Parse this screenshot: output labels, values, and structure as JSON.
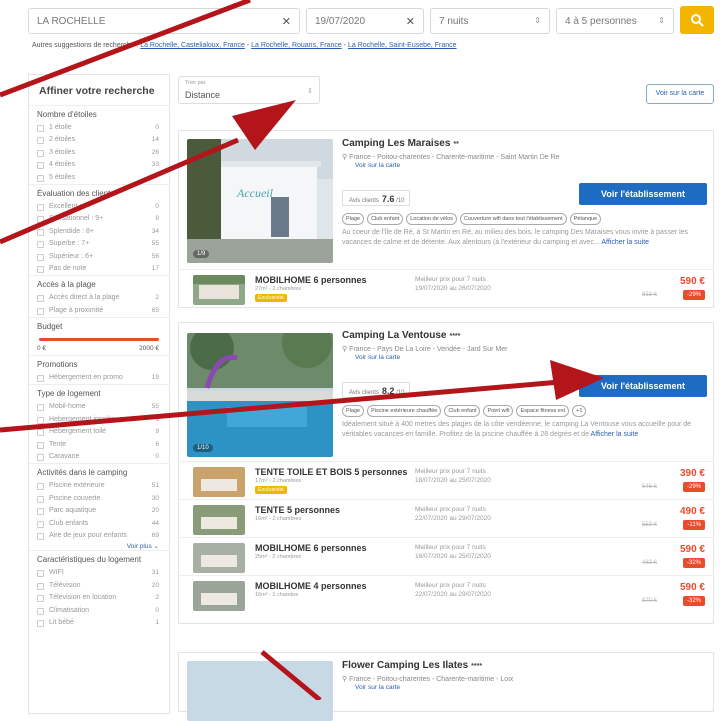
{
  "search": {
    "destination": "LA ROCHELLE",
    "date": "19/07/2020",
    "nights": "7 nuits",
    "persons": "4 à 5 personnes",
    "alt_prefix": "Autres suggestions de recherche :",
    "alt_links": [
      "La Rochelle, Castelialoux, France",
      "La Rochelle, Rouans, France",
      "La Rochelle, Saint-Eusebe, France"
    ]
  },
  "sidebar": {
    "title": "Affiner votre recherche",
    "sections": {
      "stars": {
        "title": "Nombre d'étoiles",
        "items": [
          {
            "label": "1 étoile",
            "count": "0"
          },
          {
            "label": "2 étoiles",
            "count": "14"
          },
          {
            "label": "3 étoiles",
            "count": "26"
          },
          {
            "label": "4 étoiles",
            "count": "33"
          },
          {
            "label": "5 étoiles",
            "count": ""
          }
        ]
      },
      "rating": {
        "title": "Évaluation des clients",
        "items": [
          {
            "label": "Excellent : 9+",
            "count": "0"
          },
          {
            "label": "Sensationnel : 9+",
            "count": "9"
          },
          {
            "label": "Splendide : 8+",
            "count": "34"
          },
          {
            "label": "Superbe : 7+",
            "count": "55"
          },
          {
            "label": "Supérieur : 6+",
            "count": "56"
          },
          {
            "label": "Pas de note",
            "count": "17"
          }
        ]
      },
      "beach": {
        "title": "Accès à la plage",
        "items": [
          {
            "label": "Accès direct à la plage",
            "count": "2"
          },
          {
            "label": "Plage à proximité",
            "count": "65"
          }
        ]
      },
      "budget": {
        "title": "Budget",
        "min": "0 €",
        "max": "2000 €"
      },
      "promo": {
        "title": "Promotions",
        "items": [
          {
            "label": "Hébergement en promo",
            "count": "19"
          }
        ]
      },
      "housing": {
        "title": "Type de logement",
        "items": [
          {
            "label": "Mobil-home",
            "count": "55"
          },
          {
            "label": "Hebergement insolite",
            "count": "1"
          },
          {
            "label": "Hébergement toilé",
            "count": "9"
          },
          {
            "label": "Tente",
            "count": "6"
          },
          {
            "label": "Caravane",
            "count": "0"
          }
        ]
      },
      "activities": {
        "title": "Activités dans le camping",
        "items": [
          {
            "label": "Piscine extérieure",
            "count": "51"
          },
          {
            "label": "Piscine couverte",
            "count": "30"
          },
          {
            "label": "Parc aquatique",
            "count": "20"
          },
          {
            "label": "Club enfants",
            "count": "44"
          },
          {
            "label": "Aire de jeux pour enfants",
            "count": "69"
          }
        ],
        "more": "Voir plus"
      },
      "features": {
        "title": "Caractéristiques du logement",
        "items": [
          {
            "label": "WIFI",
            "count": "31"
          },
          {
            "label": "Télévision",
            "count": "20"
          },
          {
            "label": "Télévision en location",
            "count": "2"
          },
          {
            "label": "Climatisation",
            "count": "0"
          },
          {
            "label": "Lit bébé",
            "count": "1"
          }
        ]
      }
    }
  },
  "sort": {
    "label": "Trier par",
    "value": "Distance"
  },
  "map_button": "Voir sur la carte",
  "cards": [
    {
      "name": "Camping Les Maraises",
      "stars": "**",
      "location": "France - Poitou-charentes - Charente-maritime - Saint Martin De Re",
      "map_link": "Voir sur la carte",
      "rating_label": "Avis clients",
      "rating": "7.6",
      "rating_max": "/10",
      "button": "Voir l'établissement",
      "photo_count": "1/9",
      "tags": [
        "Plage",
        "Club enfant",
        "Location de vélos",
        "Couverture wifi dans tout l'établissement",
        "Pétanque"
      ],
      "description": "Au coeur de l'île de Ré, à St Martin en Ré, au milieu des bois, le camping Des Maraises vous invite à passer les vacances de calme et de détente. Aux alentours (à l'extérieur du camping et avec...",
      "more": "Afficher la suite",
      "offers": [
        {
          "title": "MOBILHOME 6 personnes",
          "sub": "27m² - 2 chambres",
          "badge": "Exclusivité",
          "best": "Meilleur prix pour 7 nuits",
          "dates": "19/07/2020 au 26/07/2020",
          "price": "590 €",
          "old": "833 €",
          "discount": "-29%"
        }
      ]
    },
    {
      "name": "Camping La Ventouse",
      "stars": "****",
      "location": "France - Pays De La Loire - Vendée - Jard Sur Mer",
      "map_link": "Voir sur la carte",
      "rating_label": "Avis clients",
      "rating": "8.2",
      "rating_max": "/10",
      "button": "Voir l'établissement",
      "photo_count": "1/10",
      "tags": [
        "Plage",
        "Piscine extérieure chauffée",
        "Club enfant",
        "Point wifi",
        "Espace fitness ext",
        "+1"
      ],
      "description": "Idéalement situé à 400 mètres des plages de la côte vendéenne, le camping La Ventouse vous accueille pour de véritables vacances en famille. Profitez de la piscine chauffée à 28 degrés et de",
      "more": "Afficher la suite",
      "offers": [
        {
          "title": "TENTE TOILE ET BOIS 5 personnes",
          "sub": "17m² - 2 chambres",
          "badge": "Exclusivité",
          "best": "Meilleur prix pour 7 nuits",
          "dates": "18/07/2020 au 25/07/2020",
          "price": "390 €",
          "old": "546 €",
          "discount": "-29%"
        },
        {
          "title": "TENTE 5 personnes",
          "sub": "16m² - 2 chambres",
          "badge": "",
          "best": "Meilleur prix pour 7 nuits",
          "dates": "22/07/2020 au 29/07/2020",
          "price": "490 €",
          "old": "553 €",
          "discount": "-11%"
        },
        {
          "title": "MOBILHOME 6 personnes",
          "sub": "25m² - 2 chambres",
          "badge": "",
          "best": "Meilleur prix pour 7 nuits",
          "dates": "18/07/2020 au 25/07/2020",
          "price": "590 €",
          "old": "483 €",
          "discount": "-32%"
        },
        {
          "title": "MOBILHOME 4 personnes",
          "sub": "16m² - 1 chambre",
          "badge": "",
          "best": "Meilleur prix pour 7 nuits",
          "dates": "22/07/2020 au 29/07/2020",
          "price": "590 €",
          "old": "870 €",
          "discount": "-32%"
        }
      ]
    },
    {
      "name": "Flower Camping Les Ilates",
      "stars": "****",
      "location": "France - Poitou-charentes - Charente-maritime - Loix",
      "map_link": "Voir sur la carte"
    }
  ],
  "colors": {
    "accent": "#1e6bc2",
    "price": "#e84c2c",
    "search": "#f3b500",
    "arrow": "#b3151a"
  }
}
